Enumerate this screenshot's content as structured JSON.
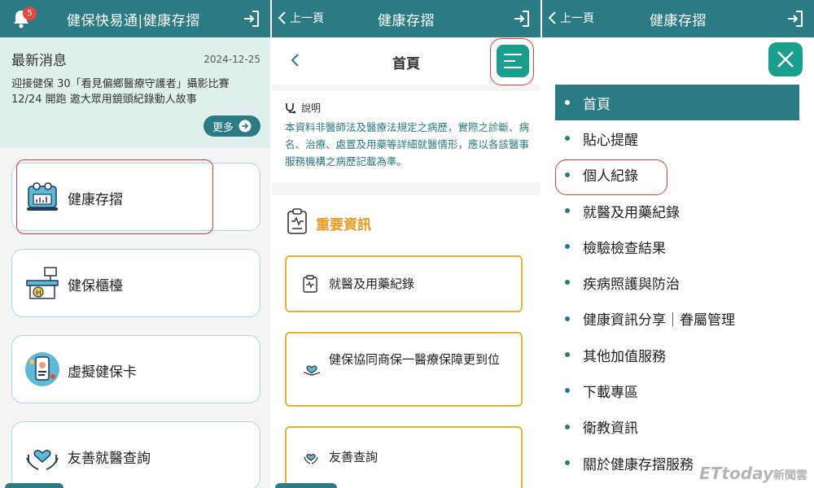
{
  "panel1": {
    "header": {
      "title": "健保快易通|健康存摺",
      "badge_count": "5"
    },
    "news": {
      "title": "最新消息",
      "date": "2024-12-25",
      "text": "迎接健保 30「看見偏鄉醫療守護者」攝影比賽 12/24 開跑 邀大眾用鏡頭紀錄動人故事",
      "more_label": "更多"
    },
    "cards": [
      {
        "label": "健康存摺",
        "icon": "health-passbook-icon"
      },
      {
        "label": "健保櫃檯",
        "icon": "counter-icon"
      },
      {
        "label": "虛擬健保卡",
        "icon": "virtual-card-icon"
      },
      {
        "label": "友善就醫查詢",
        "icon": "friendly-care-icon"
      }
    ]
  },
  "panel2": {
    "header": {
      "back_label": "上一頁",
      "title": "健康存摺"
    },
    "page_title": "首頁",
    "note": {
      "label": "說明",
      "text": "本資料非醫師法及醫療法規定之病歷，實際之診斷、病名、治療、處置及用藥等詳細就醫情形，應以各該醫事服務機構之病歷記載為準。"
    },
    "important": {
      "title": "重要資訊",
      "items": [
        {
          "label": "就醫及用藥紀錄"
        },
        {
          "label": "健保協同商保一醫療保障更到位"
        },
        {
          "label": "友善查詢"
        }
      ]
    }
  },
  "panel3": {
    "header": {
      "back_label": "上一頁",
      "title": "健康存摺"
    },
    "menu": [
      "首頁",
      "貼心提醒",
      "個人紀錄",
      "就醫及用藥紀錄",
      "檢驗檢查結果",
      "疾病照護與防治",
      "健康資訊分享｜眷屬管理",
      "其他加值服務",
      "下載專區",
      "衛教資訊",
      "關於健康存摺服務"
    ],
    "active_index": 0
  },
  "watermark": {
    "brand": "ETtoday",
    "suffix": "新聞雲"
  },
  "colors": {
    "teal": "#2a7b84",
    "accent_green": "#1a9e8d",
    "orange": "#e89a22",
    "highlight_red": "#d9403a"
  }
}
